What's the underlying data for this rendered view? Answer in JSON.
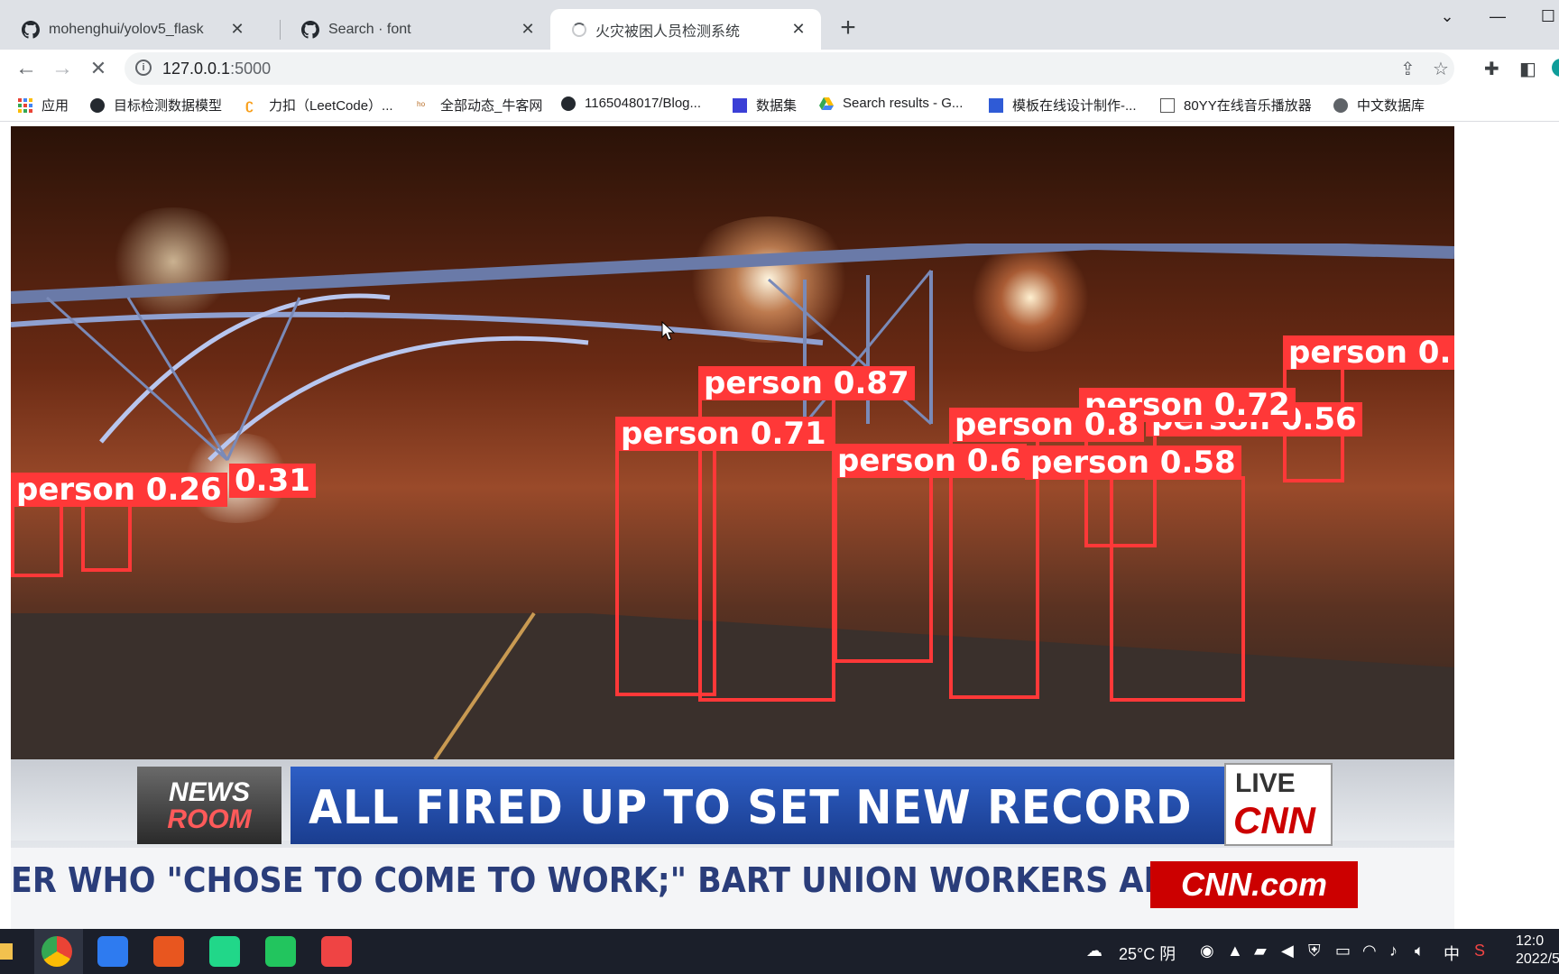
{
  "browser": {
    "tabs": [
      {
        "title": "mohenghui/yolov5_flask",
        "icon": "github-icon"
      },
      {
        "title": "Search · font",
        "icon": "github-icon"
      },
      {
        "title": "火灾被困人员检测系统",
        "icon": "loading-spinner"
      }
    ],
    "new_tab_glyph": "+",
    "address": {
      "host": "127.0.0.1",
      "port": ":5000"
    },
    "bookmarks": [
      {
        "label": "应用",
        "icon": "apps-grid-icon"
      },
      {
        "label": "目标检测数据模型",
        "icon": "github-icon"
      },
      {
        "label": "力扣（LeetCode）...",
        "icon": "leetcode-icon"
      },
      {
        "label": "全部动态_牛客网",
        "icon": "nowcoder-icon"
      },
      {
        "label": "1165048017/Blog...",
        "icon": "github-icon"
      },
      {
        "label": "数据集",
        "icon": "dataset-icon"
      },
      {
        "label": "Search results - G...",
        "icon": "google-drive-icon"
      },
      {
        "label": "模板在线设计制作-...",
        "icon": "template-icon"
      },
      {
        "label": "80YY在线音乐播放器",
        "icon": "music-icon"
      },
      {
        "label": "中文数据库",
        "icon": "globe-icon"
      }
    ]
  },
  "video": {
    "detections": [
      {
        "label": "person 0.",
        "color": "#ff3838"
      },
      {
        "label": "person 0.87",
        "color": "#ff3838"
      },
      {
        "label": "person 0.72",
        "color": "#ff3838"
      },
      {
        "label": "person 0.56",
        "color": "#ff3838"
      },
      {
        "label": "person 0.71",
        "color": "#ff3838"
      },
      {
        "label": "person 0.8",
        "color": "#ff3838"
      },
      {
        "label": "person 0.6",
        "color": "#ff3838"
      },
      {
        "label": "person 0.58",
        "color": "#ff3838"
      },
      {
        "label": "person 0.26",
        "color": "#ff3838"
      },
      {
        "label": "0.31",
        "color": "#ff3838"
      }
    ],
    "overlay": {
      "newsroom_top": "NEWS",
      "newsroom_bottom": "ROOM",
      "headline": "ALL FIRED UP TO SET NEW RECORD",
      "live": "LIVE",
      "network": "CNN",
      "crawl": "ER WHO \"CHOSE TO COME TO WORK;\" BART UNION WORKERS ARE C",
      "site": "CNN.com"
    }
  },
  "taskbar": {
    "weather": "25°C 阴",
    "ime": "中",
    "clock_time": "12:0",
    "clock_date": "2022/5"
  }
}
